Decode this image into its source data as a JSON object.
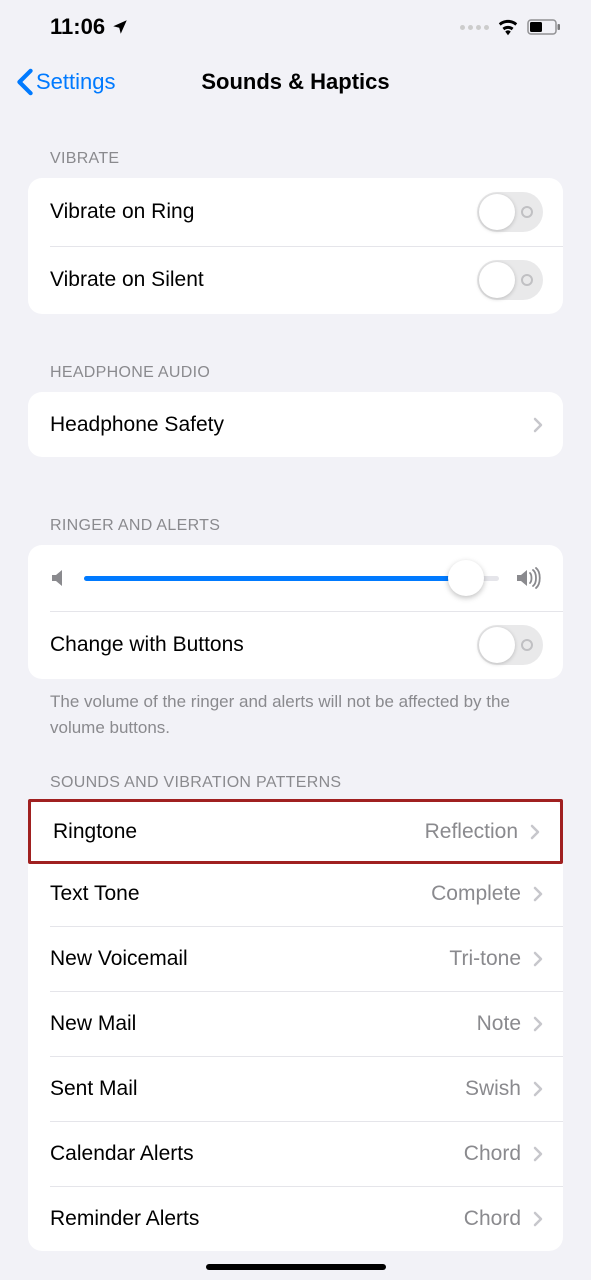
{
  "status": {
    "time": "11:06"
  },
  "nav": {
    "back_label": "Settings",
    "title": "Sounds & Haptics"
  },
  "sections": {
    "vibrate": {
      "header": "Vibrate",
      "rows": [
        {
          "label": "Vibrate on Ring",
          "on": false
        },
        {
          "label": "Vibrate on Silent",
          "on": false
        }
      ]
    },
    "headphone": {
      "header": "Headphone Audio",
      "rows": [
        {
          "label": "Headphone Safety"
        }
      ]
    },
    "ringer": {
      "header": "Ringer and Alerts",
      "slider_value": 92,
      "change_label": "Change with Buttons",
      "change_on": false,
      "footer": "The volume of the ringer and alerts will not be affected by the volume buttons."
    },
    "sounds": {
      "header": "Sounds and Vibration Patterns",
      "rows": [
        {
          "label": "Ringtone",
          "value": "Reflection",
          "highlighted": true
        },
        {
          "label": "Text Tone",
          "value": "Complete"
        },
        {
          "label": "New Voicemail",
          "value": "Tri-tone"
        },
        {
          "label": "New Mail",
          "value": "Note"
        },
        {
          "label": "Sent Mail",
          "value": "Swish"
        },
        {
          "label": "Calendar Alerts",
          "value": "Chord"
        },
        {
          "label": "Reminder Alerts",
          "value": "Chord"
        }
      ]
    }
  }
}
